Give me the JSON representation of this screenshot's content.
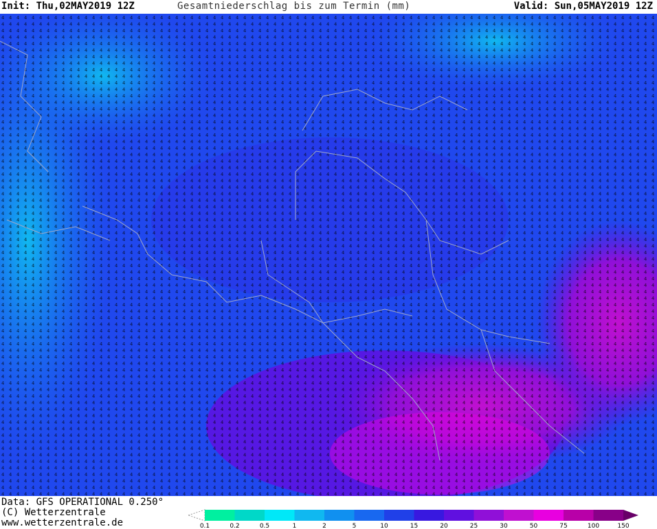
{
  "header": {
    "init": "Init: Thu,02MAY2019 12Z",
    "title": "Gesamtniederschlag bis zum Termin (mm)",
    "valid": "Valid: Sun,05MAY2019 12Z"
  },
  "footer": {
    "data_source": "Data: GFS OPERATIONAL 0.250°",
    "copyright": "(C) Wetterzentrale",
    "website": "www.wetterzentrale.de"
  },
  "legend": {
    "levels": [
      "0.1",
      "0.2",
      "0.5",
      "1",
      "2",
      "5",
      "10",
      "15",
      "20",
      "25",
      "30",
      "50",
      "75",
      "100",
      "150"
    ],
    "colors": [
      "#ffffff",
      "#00f0a0",
      "#00d8c8",
      "#00e8f8",
      "#10b8f0",
      "#1090f0",
      "#1868f0",
      "#2040e8",
      "#3818e0",
      "#6010e0",
      "#9010d8",
      "#c010d0",
      "#e800e0",
      "#b800a8",
      "#880088",
      "#680068"
    ]
  }
}
